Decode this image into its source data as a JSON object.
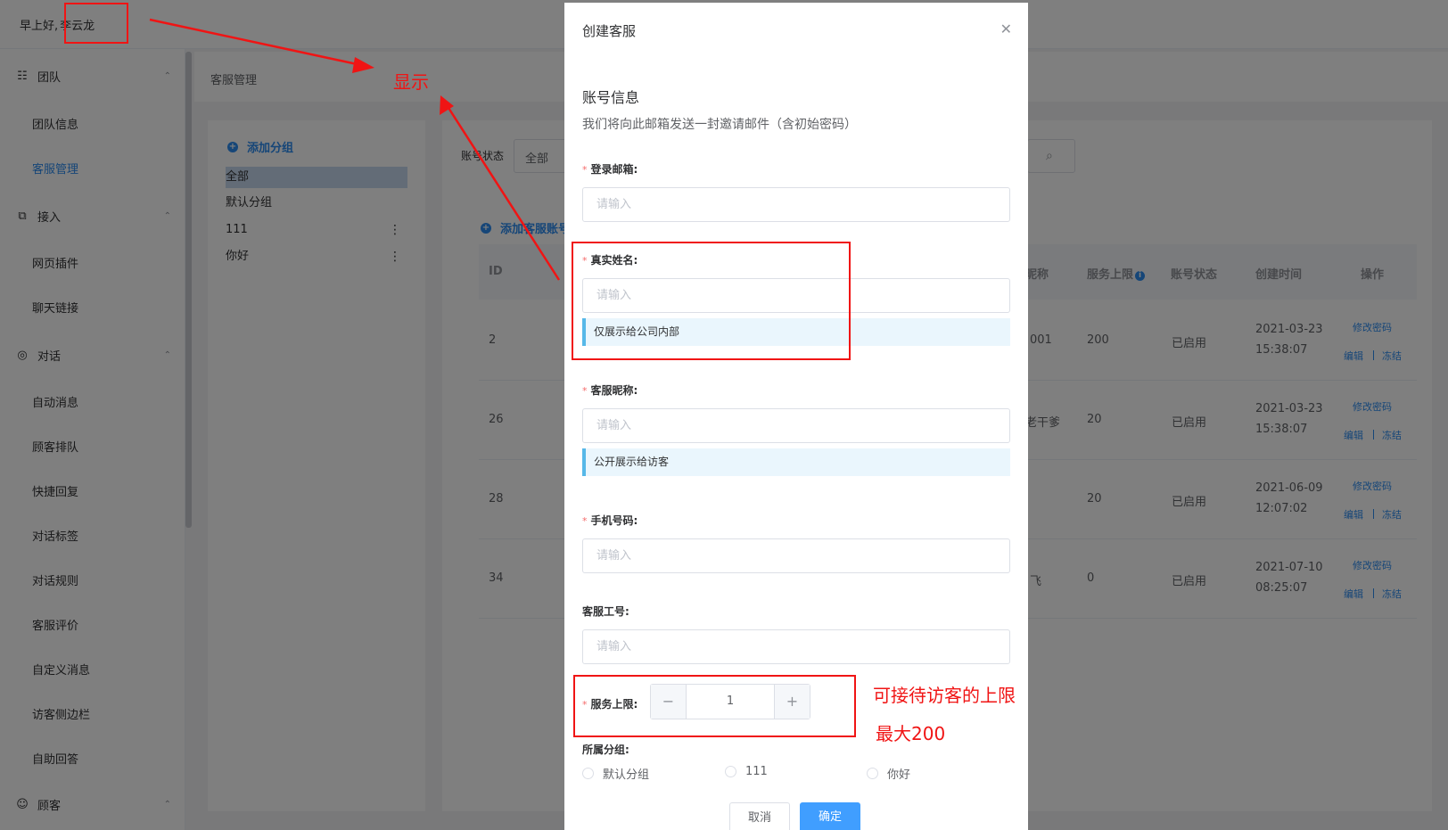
{
  "header": {
    "greeting": "早上好,",
    "username": "李云龙"
  },
  "sidebar": {
    "groups": [
      {
        "label": "团队",
        "items": [
          "团队信息",
          "客服管理"
        ]
      },
      {
        "label": "接入",
        "items": [
          "网页插件",
          "聊天链接"
        ]
      },
      {
        "label": "对话",
        "items": [
          "自动消息",
          "顾客排队",
          "快捷回复",
          "对话标签",
          "对话规则",
          "客服评价",
          "自定义消息",
          "访客侧边栏",
          "自助回答"
        ]
      },
      {
        "label": "顾客",
        "items": []
      }
    ]
  },
  "breadcrumb": "客服管理",
  "groups_panel": {
    "add_label": "添加分组",
    "items": [
      "全部",
      "默认分组",
      "111",
      "你好"
    ]
  },
  "filter": {
    "label": "账号状态",
    "value": "全部"
  },
  "add_agent_label": "添加客服账号",
  "table": {
    "headers": [
      "ID",
      "昵称",
      "服务上限",
      "账号状态",
      "创建时间",
      "操作"
    ],
    "rows": [
      {
        "id": "2",
        "nick": "001",
        "limit": "200",
        "status": "已启用",
        "date": "2021-03-23",
        "time": "15:38:07"
      },
      {
        "id": "26",
        "nick": "老干爹",
        "limit": "20",
        "status": "已启用",
        "date": "2021-03-23",
        "time": "15:38:07"
      },
      {
        "id": "28",
        "nick": "",
        "limit": "20",
        "status": "已启用",
        "date": "2021-06-09",
        "time": "12:07:02"
      },
      {
        "id": "34",
        "nick": "飞",
        "limit": "0",
        "status": "已启用",
        "date": "2021-07-10",
        "time": "08:25:07"
      }
    ],
    "actions": {
      "change_pwd": "修改密码",
      "edit": "编辑",
      "freeze": "冻结"
    }
  },
  "dialog": {
    "title": "创建客服",
    "section_title": "账号信息",
    "section_sub": "我们将向此邮箱发送一封邀请邮件（含初始密码）",
    "fields": {
      "email": {
        "label": "登录邮箱:",
        "placeholder": "请输入"
      },
      "realname": {
        "label": "真实姓名:",
        "placeholder": "请输入",
        "tip": "仅展示给公司内部"
      },
      "nickname": {
        "label": "客服昵称:",
        "placeholder": "请输入",
        "tip": "公开展示给访客"
      },
      "phone": {
        "label": "手机号码:",
        "placeholder": "请输入"
      },
      "jobno": {
        "label": "客服工号:",
        "placeholder": "请输入"
      },
      "limit": {
        "label": "服务上限:",
        "value": "1"
      },
      "group": {
        "label": "所属分组:",
        "options": [
          "默认分组",
          "111",
          "你好"
        ]
      }
    },
    "cancel": "取消",
    "confirm": "确定"
  },
  "annotations": {
    "show": "显示",
    "limit_note_1": "可接待访客的上限",
    "limit_note_2": "最大200",
    "color": "#f01414"
  }
}
